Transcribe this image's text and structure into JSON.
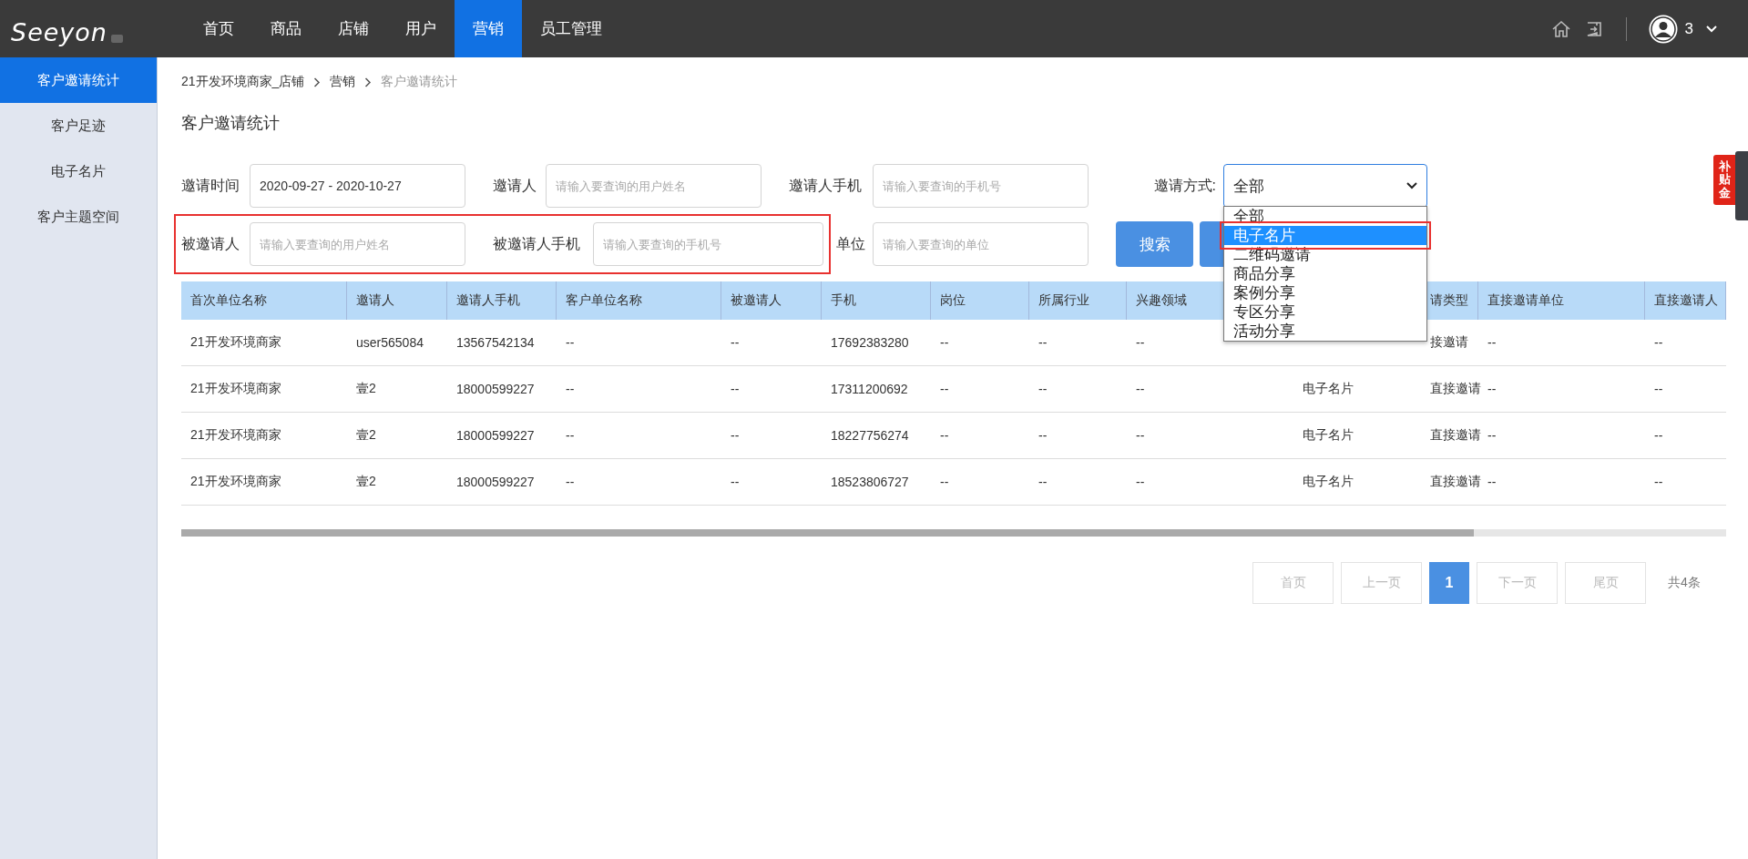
{
  "topbar": {
    "logo": "Seeyon",
    "nav": [
      {
        "label": "首页",
        "selected": false
      },
      {
        "label": "商品",
        "selected": false
      },
      {
        "label": "店铺",
        "selected": false
      },
      {
        "label": "用户",
        "selected": false
      },
      {
        "label": "营销",
        "selected": true
      },
      {
        "label": "员工管理",
        "selected": false
      }
    ],
    "user": "3"
  },
  "sidebar": {
    "items": [
      {
        "label": "客户邀请统计",
        "selected": true
      },
      {
        "label": "客户足迹",
        "selected": false
      },
      {
        "label": "电子名片",
        "selected": false
      },
      {
        "label": "客户主题空间",
        "selected": false
      }
    ]
  },
  "breadcrumb": [
    {
      "label": "21开发环境商家_店铺",
      "current": false
    },
    {
      "label": "营销",
      "current": false
    },
    {
      "label": "客户邀请统计",
      "current": true
    }
  ],
  "page_title": "客户邀请统计",
  "filters": [
    [
      {
        "highlighted": false,
        "fields": [
          {
            "kind": "text",
            "label": "邀请时间",
            "value": "2020-09-27 - 2020-10-27"
          },
          {
            "kind": "text",
            "label": "邀请人",
            "placeholder": "请输入要查询的用户姓名"
          },
          {
            "kind": "text",
            "label": "邀请人手机",
            "placeholder": "请输入要查询的手机号"
          },
          {
            "kind": "select",
            "label": "邀请方式:",
            "value": "全部"
          }
        ]
      }
    ],
    [
      {
        "highlighted": true,
        "fields": [
          {
            "kind": "text",
            "label": "被邀请人",
            "placeholder": "请输入要查询的用户姓名"
          },
          {
            "kind": "text",
            "label": "被邀请人手机",
            "placeholder": "请输入要查询的手机号"
          }
        ]
      },
      {
        "highlighted": false,
        "fields": [
          {
            "kind": "text",
            "label": "单位",
            "placeholder": "请输入要查询的单位"
          },
          {
            "kind": "button",
            "label": "搜索"
          },
          {
            "kind": "button"
          }
        ]
      }
    ]
  ],
  "dropdown": {
    "expanded": true,
    "options": [
      {
        "label": "全部",
        "selected": false,
        "highlighted": false
      },
      {
        "label": "电子名片",
        "selected": true,
        "highlighted": true
      },
      {
        "label": "二维码邀请",
        "selected": false,
        "highlighted": false
      },
      {
        "label": "商品分享",
        "selected": false,
        "highlighted": false
      },
      {
        "label": "案例分享",
        "selected": false,
        "highlighted": false
      },
      {
        "label": "专区分享",
        "selected": false,
        "highlighted": false
      },
      {
        "label": "活动分享",
        "selected": false,
        "highlighted": false
      }
    ]
  },
  "side_badge": "补贴金",
  "table": {
    "columns": [
      "首次单位名称",
      "邀请人",
      "邀请人手机",
      "客户单位名称",
      "被邀请人",
      "手机",
      "岗位",
      "所属行业",
      "兴趣领域",
      null,
      "请类型",
      "直接邀请单位",
      "直接邀请人"
    ],
    "rows": [
      [
        "21开发环境商家",
        "user565084",
        "13567542134",
        "--",
        "--",
        "17692383280",
        "--",
        "--",
        "--",
        null,
        "接邀请",
        "--",
        "--"
      ],
      [
        "21开发环境商家",
        "壹2",
        "18000599227",
        "--",
        "--",
        "17311200692",
        "--",
        "--",
        "--",
        "电子名片",
        "直接邀请",
        "--",
        "--"
      ],
      [
        "21开发环境商家",
        "壹2",
        "18000599227",
        "--",
        "--",
        "18227756274",
        "--",
        "--",
        "--",
        "电子名片",
        "直接邀请",
        "--",
        "--"
      ],
      [
        "21开发环境商家",
        "壹2",
        "18000599227",
        "--",
        "--",
        "18523806727",
        "--",
        "--",
        "--",
        "电子名片",
        "直接邀请",
        "--",
        "--"
      ]
    ]
  },
  "pagination": {
    "buttons": [
      {
        "label": "首页",
        "kind": "nav",
        "selected": false
      },
      {
        "label": "上一页",
        "kind": "nav",
        "selected": false
      },
      {
        "label": "1",
        "kind": "page",
        "selected": true
      },
      {
        "label": "下一页",
        "kind": "nav",
        "selected": false
      },
      {
        "label": "尾页",
        "kind": "nav",
        "selected": false
      }
    ],
    "total": "共4条"
  }
}
